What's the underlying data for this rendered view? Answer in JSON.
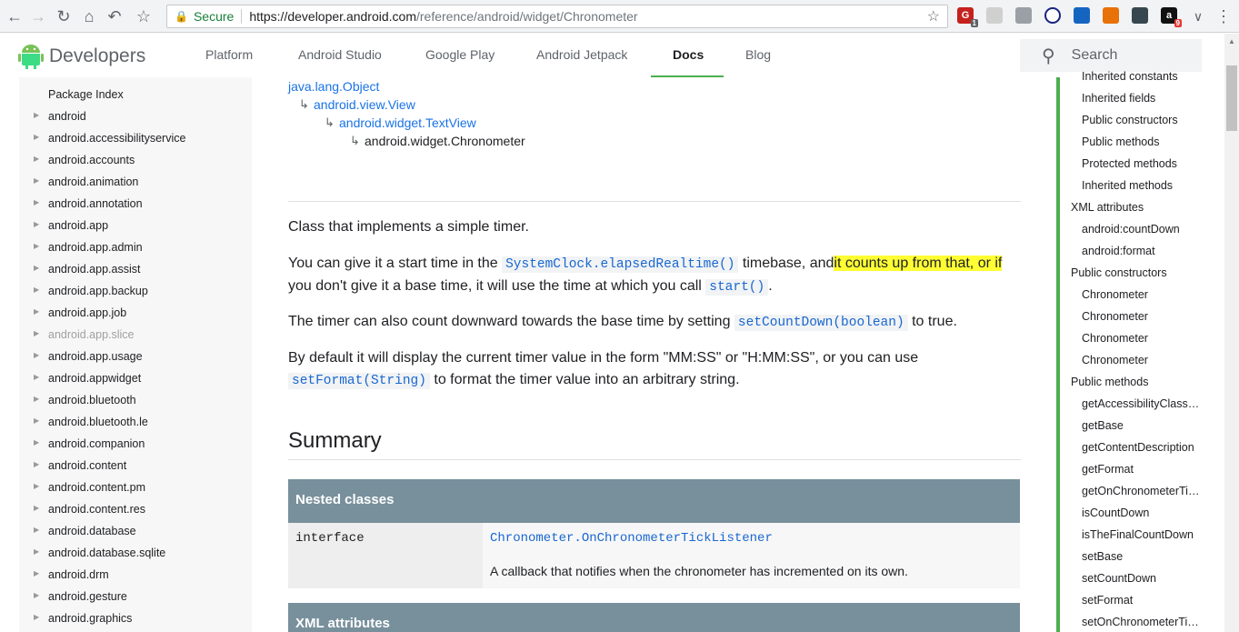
{
  "browser": {
    "secure_label": "Secure",
    "url_scheme_host": "https://developer.android.com",
    "url_path": "/reference/android/widget/Chronometer",
    "extensions": [
      {
        "name": "ext-1-icon",
        "badge": "1",
        "color": "#c5221f"
      },
      {
        "name": "ext-2-icon",
        "badge": "",
        "color": "#c0c0c0"
      },
      {
        "name": "ext-3-icon",
        "badge": "",
        "color": "#9aa0a6"
      },
      {
        "name": "ext-4-icon",
        "badge": "",
        "color": "#1a237e"
      },
      {
        "name": "ext-5-icon",
        "badge": "",
        "color": "#1565c0"
      },
      {
        "name": "ext-6-icon",
        "badge": "",
        "color": "#e8710a"
      },
      {
        "name": "ext-7-icon",
        "badge": "",
        "color": "#37474f"
      },
      {
        "name": "ext-8-icon",
        "badge": "9",
        "color": "#111111"
      }
    ]
  },
  "header": {
    "logo_text": "Developers",
    "tabs": [
      "Platform",
      "Android Studio",
      "Google Play",
      "Android Jetpack",
      "Docs",
      "Blog"
    ],
    "active_tab": "Docs",
    "search_placeholder": "Search"
  },
  "left_nav": {
    "heading": "Package Index",
    "items": [
      "android",
      "android.accessibilityservice",
      "android.accounts",
      "android.animation",
      "android.annotation",
      "android.app",
      "android.app.admin",
      "android.app.assist",
      "android.app.backup",
      "android.app.job",
      "android.app.slice",
      "android.app.usage",
      "android.appwidget",
      "android.bluetooth",
      "android.bluetooth.le",
      "android.companion",
      "android.content",
      "android.content.pm",
      "android.content.res",
      "android.database",
      "android.database.sqlite",
      "android.drm",
      "android.gesture",
      "android.graphics"
    ],
    "dim_item": "android.app.slice"
  },
  "main": {
    "hierarchy": [
      "java.lang.Object",
      "android.view.View",
      "android.widget.TextView",
      "android.widget.Chronometer"
    ],
    "p1": "Class that implements a simple timer.",
    "p2_a": "You can give it a start time in the ",
    "p2_code1": "SystemClock.elapsedRealtime()",
    "p2_b": " timebase, and",
    "p2_hl": "it counts up from that, or if ",
    "p2_c": "you don't give it a base time, it will use the time at which you call ",
    "p2_code2": "start()",
    "p2_d": ".",
    "p3_a": "The timer can also count downward towards the base time by setting ",
    "p3_code": "setCountDown(boolean)",
    "p3_b": " to true.",
    "p4_a": "By default it will display the current timer value in the form \"MM:SS\" or \"H:MM:SS\", or you can use",
    "p4_code": "setFormat(String)",
    "p4_b": " to format the timer value into an arbitrary string.",
    "summary_heading": "Summary",
    "nested_classes_title": "Nested classes",
    "nested_kw": "interface",
    "nested_ref": "Chronometer.OnChronometerTickListener",
    "nested_desc": "A callback that notifies when the chronometer has incremented on its own.",
    "xml_attributes_title": "XML attributes"
  },
  "toc": {
    "items": [
      {
        "label": "Inherited constants",
        "indent": true
      },
      {
        "label": "Inherited fields",
        "indent": true
      },
      {
        "label": "Public constructors",
        "indent": true
      },
      {
        "label": "Public methods",
        "indent": true
      },
      {
        "label": "Protected methods",
        "indent": true
      },
      {
        "label": "Inherited methods",
        "indent": true
      },
      {
        "label": "XML attributes",
        "indent": false
      },
      {
        "label": "android:countDown",
        "indent": true
      },
      {
        "label": "android:format",
        "indent": true
      },
      {
        "label": "Public constructors",
        "indent": false
      },
      {
        "label": "Chronometer",
        "indent": true
      },
      {
        "label": "Chronometer",
        "indent": true
      },
      {
        "label": "Chronometer",
        "indent": true
      },
      {
        "label": "Chronometer",
        "indent": true
      },
      {
        "label": "Public methods",
        "indent": false
      },
      {
        "label": "getAccessibilityClass…",
        "indent": true
      },
      {
        "label": "getBase",
        "indent": true
      },
      {
        "label": "getContentDescription",
        "indent": true
      },
      {
        "label": "getFormat",
        "indent": true
      },
      {
        "label": "getOnChronometerTi…",
        "indent": true
      },
      {
        "label": "isCountDown",
        "indent": true
      },
      {
        "label": "isTheFinalCountDown",
        "indent": true
      },
      {
        "label": "setBase",
        "indent": true
      },
      {
        "label": "setCountDown",
        "indent": true
      },
      {
        "label": "setFormat",
        "indent": true
      },
      {
        "label": "setOnChronometerTi…",
        "indent": true
      }
    ]
  }
}
